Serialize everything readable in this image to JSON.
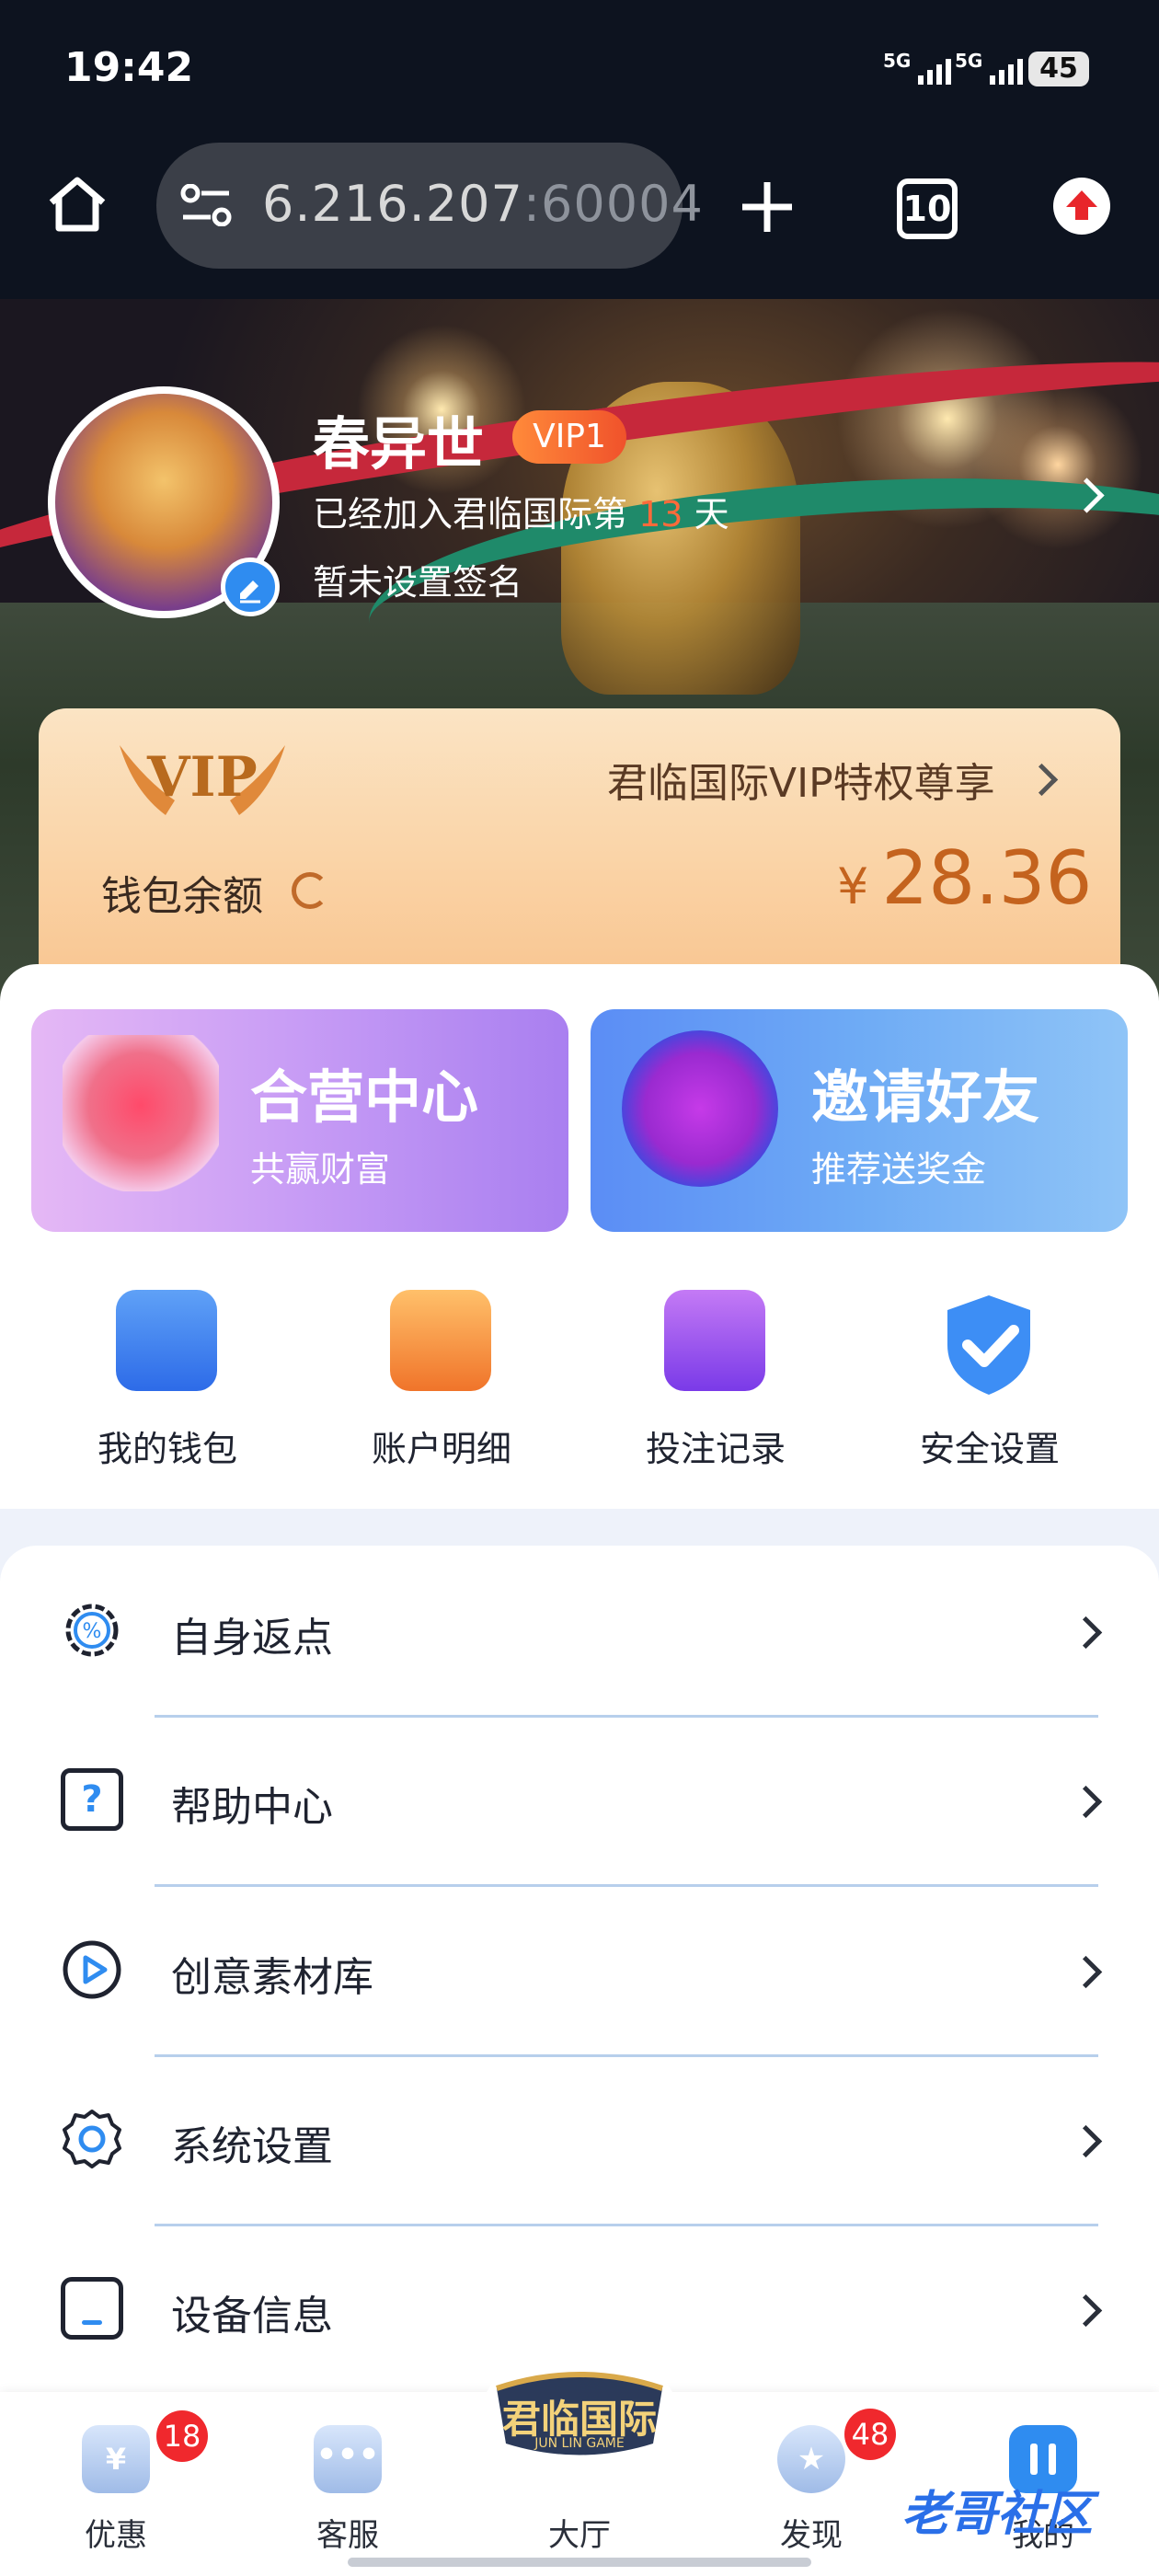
{
  "status_bar": {
    "time": "19:42",
    "signal1": "5G",
    "signal2": "5G",
    "battery": "45"
  },
  "browser": {
    "url_visible": "6.216.207",
    "url_port": ":60004",
    "tab_count": "10"
  },
  "profile": {
    "username": "春异世",
    "vip_level": "VIP1",
    "joined_prefix": "已经加入君临国际第",
    "joined_days": "13",
    "joined_suffix": "天",
    "signature": "暂未设置签名"
  },
  "vip_card": {
    "badge_text": "VIP",
    "privilege_link": "君临国际VIP特权尊享",
    "wallet_label": "钱包余额",
    "currency": "¥",
    "balance": "28.36"
  },
  "promo_cards": [
    {
      "title": "合营中心",
      "subtitle": "共赢财富"
    },
    {
      "title": "邀请好友",
      "subtitle": "推荐送奖金"
    }
  ],
  "quick_actions": [
    {
      "label": "我的钱包",
      "icon": "wallet-icon"
    },
    {
      "label": "账户明细",
      "icon": "account-detail-icon"
    },
    {
      "label": "投注记录",
      "icon": "bet-record-icon"
    },
    {
      "label": "安全设置",
      "icon": "security-shield-icon"
    }
  ],
  "menu": [
    {
      "label": "自身返点",
      "icon": "rebate-percent-icon"
    },
    {
      "label": "帮助中心",
      "icon": "help-question-icon"
    },
    {
      "label": "创意素材库",
      "icon": "play-circle-icon"
    },
    {
      "label": "系统设置",
      "icon": "gear-icon"
    },
    {
      "label": "设备信息",
      "icon": "device-icon"
    }
  ],
  "bottom_nav": {
    "items": [
      {
        "label": "优惠",
        "badge": "18",
        "icon": "coupon-icon"
      },
      {
        "label": "客服",
        "icon": "chat-icon"
      },
      {
        "label": "大厅",
        "icon": "lobby-logo"
      },
      {
        "label": "发现",
        "badge": "48",
        "icon": "discover-medal-icon"
      },
      {
        "label": "我的",
        "icon": "profile-icon"
      }
    ],
    "logo_text": "君临国际",
    "logo_sub": "JUN LIN GAME"
  },
  "watermark": "老哥社区",
  "colors": {
    "accent_orange": "#c4631e",
    "badge_red": "#f0282d",
    "brand_blue": "#2f8cf0"
  }
}
